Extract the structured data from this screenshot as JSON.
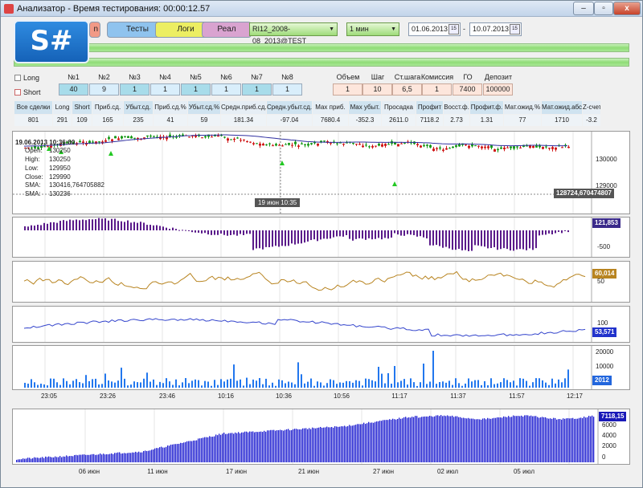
{
  "window": {
    "title": "Анализатор - Время тестирования: 00:00:12.57",
    "btn_minimize": "–",
    "btn_maximize": "▫",
    "btn_close": "x"
  },
  "logo": "S#",
  "toolbar": {
    "btn_hidden": "n",
    "tests": "Тесты",
    "logs": "Логи",
    "real": "Реал",
    "security": "RI12_2008-08_2013@TEST",
    "timeframe": "1 мин",
    "date_from": "01.06.2013",
    "date_sep": "-",
    "date_to": "10.07.2013",
    "cal": "15"
  },
  "colors": {
    "tests": "#8fc3ee",
    "logs": "#ecee62",
    "real": "#d9a3d0",
    "hidden": "#f29a86"
  },
  "direction": {
    "long": "Long",
    "short": "Short"
  },
  "params": {
    "headers": [
      "№1",
      "№2",
      "№3",
      "№4",
      "№5",
      "№6",
      "№7",
      "№8"
    ],
    "values": [
      "40",
      "9",
      "1",
      "1",
      "1",
      "1",
      "1",
      "1"
    ]
  },
  "settings": {
    "headers": [
      "Объем",
      "Шаг",
      "Ст.шага",
      "Комиссия",
      "ГО",
      "Депозит"
    ],
    "values": [
      "1",
      "10",
      "6,5",
      "1",
      "7400",
      "100000"
    ]
  },
  "stats": {
    "headers": [
      "Все сделки",
      "Long",
      "Short",
      "Приб.сд.",
      "Убыт.сд.",
      "Приб.сд.%",
      "Убыт.сд.%",
      "Средн.приб.сд.",
      "Средн.убыт.сд.",
      "Max приб.",
      "Max убыт.",
      "Просадка",
      "Профит",
      "Восст.ф.",
      "Профит.ф.",
      "Мат.ожид.%",
      "Мат.ожид.абс",
      "Z-счет"
    ],
    "values": [
      "801",
      "291",
      "109",
      "165",
      "235",
      "41",
      "59",
      "181.34",
      "-97.04",
      "7680.4",
      "-352.3",
      "2611.0",
      "7118.2",
      "2.73",
      "1.31",
      "77",
      "1710",
      "-3.2"
    ]
  },
  "price_chart": {
    "ohlc_header": "19.06.2013 10:36:00",
    "open_label": "Open:",
    "open": "130250",
    "high_label": "High:",
    "high": "130250",
    "low_label": "Low:",
    "low": "129950",
    "close_label": "Close:",
    "close": "129990",
    "sma1_label": "SMA:",
    "sma1": "130416,764705882",
    "sma2_label": "SMA:",
    "sma2": "130236",
    "crosshair_time": "19 июн 10:35",
    "price_tag": "128724,670474807",
    "axis_labels": [
      "130000",
      "129000"
    ]
  },
  "osc1": {
    "tag": "121,853",
    "axis_labels": [
      "-500"
    ]
  },
  "osc2": {
    "tag": "60,014",
    "axis_labels": [
      "50"
    ]
  },
  "osc3": {
    "tag": "53,571",
    "axis_labels": [
      "100"
    ]
  },
  "volume": {
    "tag": "2012",
    "axis_labels": [
      "20000",
      "10000"
    ]
  },
  "time_axis": [
    "23:05",
    "23:26",
    "23:46",
    "10:16",
    "10:36",
    "10:56",
    "11:17",
    "11:37",
    "11:57",
    "12:17"
  ],
  "equity": {
    "tag": "7118,15",
    "axis_labels": [
      "6000",
      "4000",
      "2000",
      "0"
    ],
    "date_labels": [
      "06 июн",
      "11 июн",
      "17 июн",
      "21 июн",
      "27 июн",
      "02 июл",
      "05 июл"
    ]
  }
}
